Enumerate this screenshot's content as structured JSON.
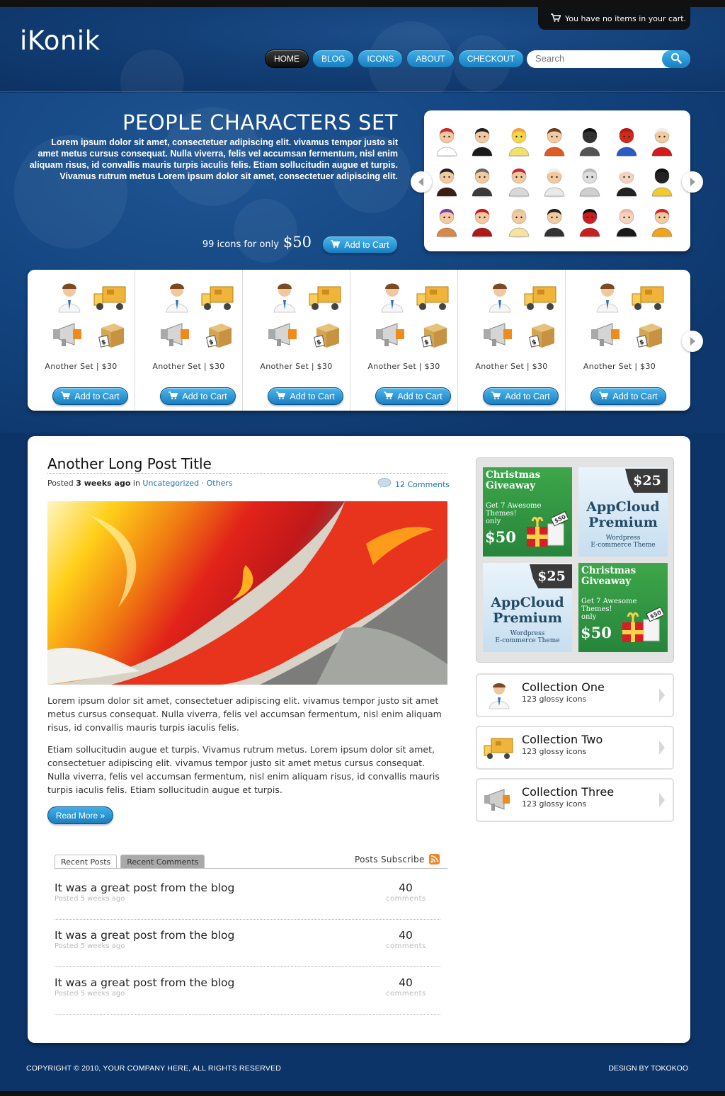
{
  "site": {
    "logo": "iKonik"
  },
  "cart": {
    "text": "You have no items in your cart."
  },
  "nav": [
    {
      "label": "HOME",
      "active": true
    },
    {
      "label": "BLOG",
      "active": false
    },
    {
      "label": "ICONS",
      "active": false
    },
    {
      "label": "ABOUT",
      "active": false
    },
    {
      "label": "CHECKOUT",
      "active": false
    }
  ],
  "search": {
    "placeholder": "Search"
  },
  "hero": {
    "title": "PEOPLE CHARACTERS SET",
    "description": "Lorem ipsum dolor sit amet, consectetuer adipiscing elit. vivamus tempor justo sit amet metus cursus consequat. Nulla viverra, felis vel accumsan fermentum, nisl enim aliquam risus, id convallis mauris turpis iaculis felis. Etiam sollucitudin augue et turpis. Vivamus rutrum metus Lorem ipsum dolor sit amet, consectetuer adipiscing elit.",
    "price_prefix": "99 icons for only",
    "price": "$50",
    "cart_label": "Add to Cart"
  },
  "sets": [
    {
      "label": "Another Set | $30",
      "cart_label": "Add to Cart"
    },
    {
      "label": "Another Set | $30",
      "cart_label": "Add to Cart"
    },
    {
      "label": "Another Set | $30",
      "cart_label": "Add to Cart"
    },
    {
      "label": "Another Set | $30",
      "cart_label": "Add to Cart"
    },
    {
      "label": "Another Set | $30",
      "cart_label": "Add to Cart"
    },
    {
      "label": "Another Set | $30",
      "cart_label": "Add to Cart"
    }
  ],
  "post": {
    "title": "Another Long Post Title",
    "meta_posted": "Posted",
    "meta_age": "3 weeks ago",
    "meta_in": "in",
    "cat1": "Uncategorized",
    "cat_sep": "·",
    "cat2": "Others",
    "comments": "12 Comments",
    "p1": "Lorem ipsum dolor sit amet, consectetuer adipiscing elit. vivamus tempor justo sit amet metus cursus consequat. Nulla viverra, felis vel accumsan fermentum, nisl enim aliquam risus, id convallis mauris turpis iaculis felis.",
    "p2": "Etiam sollucitudin augue et turpis. Vivamus rutrum metus. Lorem ipsum dolor sit amet, consectetuer adipiscing elit. vivamus tempor justo sit amet metus cursus consequat. Nulla viverra, felis vel accumsan fermentum, nisl enim aliquam risus, id convallis mauris turpis iaculis felis. Etiam sollucitudin augue et turpis.",
    "read_more": "Read More »"
  },
  "tabs": {
    "recent_posts": "Recent Posts",
    "recent_comments": "Recent Comments",
    "subscribe": "Posts Subscribe"
  },
  "recent_posts": [
    {
      "title": "It was a great post from the blog",
      "date": "Posted 5 weeks ago",
      "count": "40",
      "count_label": "comments"
    },
    {
      "title": "It was a great post from the blog",
      "date": "Posted 5 weeks ago",
      "count": "40",
      "count_label": "comments"
    },
    {
      "title": "It was a great post from the blog",
      "date": "Posted 5 weeks ago",
      "count": "40",
      "count_label": "comments"
    }
  ],
  "ads": [
    {
      "kind": "giveaway",
      "title_line1": "Christmas",
      "title_line2": "Giveaway",
      "sub1": "Get 7 Awesome",
      "sub2": "Themes!",
      "sub3": "only",
      "price": "$50",
      "tag": "$50"
    },
    {
      "kind": "appcloud",
      "badge": "$25",
      "title_line1": "AppCloud",
      "title_line2": "Premium",
      "sub1": "Wordpress",
      "sub2": "E-commerce Theme"
    },
    {
      "kind": "appcloud",
      "badge": "$25",
      "title_line1": "AppCloud",
      "title_line2": "Premium",
      "sub1": "Wordpress",
      "sub2": "E-commerce Theme"
    },
    {
      "kind": "giveaway",
      "title_line1": "Christmas",
      "title_line2": "Giveaway",
      "sub1": "Get 7 Awesome",
      "sub2": "Themes!",
      "sub3": "only",
      "price": "$50",
      "tag": "$50"
    }
  ],
  "collections": [
    {
      "title": "Collection One",
      "subtitle": "123 glossy icons",
      "icon": "support-agent-icon"
    },
    {
      "title": "Collection Two",
      "subtitle": "123 glossy icons",
      "icon": "delivery-truck-icon"
    },
    {
      "title": "Collection Three",
      "subtitle": "123 glossy icons",
      "icon": "megaphone-icon"
    }
  ],
  "footer": {
    "copyright": "COPYRIGHT © 2010, YOUR COMPANY HERE, ALL RIGHTS RESERVED",
    "design": "DESIGN BY TOKOKOO"
  },
  "colors": {
    "page_bg": "#0d3468",
    "accent": "#1a7fc0",
    "link": "#1a6fb3"
  }
}
